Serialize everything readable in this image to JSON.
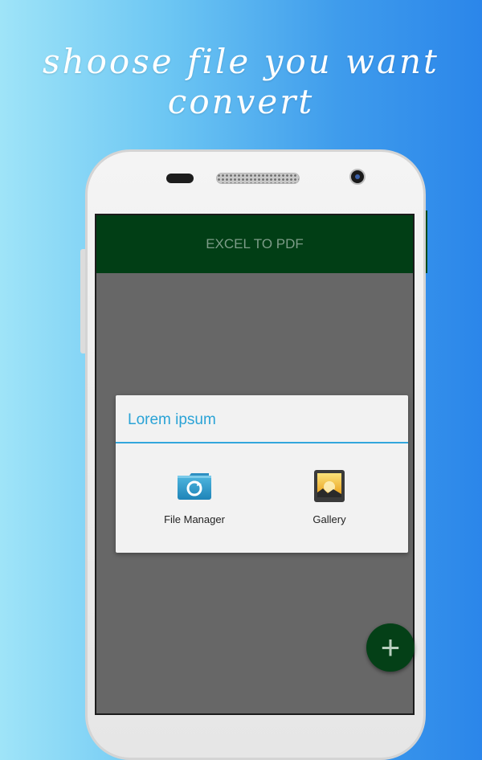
{
  "promo": {
    "line1": "shoose file you want",
    "line2": "convert"
  },
  "app_bar": {
    "title": "EXCEL TO PDF"
  },
  "dialog": {
    "title": "Lorem ipsum",
    "options": [
      {
        "label": "File Manager",
        "icon": "folder-icon"
      },
      {
        "label": "Gallery",
        "icon": "gallery-icon"
      }
    ]
  },
  "fab": {
    "icon": "plus-icon",
    "symbol": "+"
  },
  "colors": {
    "app_bar": "#013e15",
    "accent": "#2aa3d6",
    "fab": "#044017",
    "overlay": "#676767"
  }
}
